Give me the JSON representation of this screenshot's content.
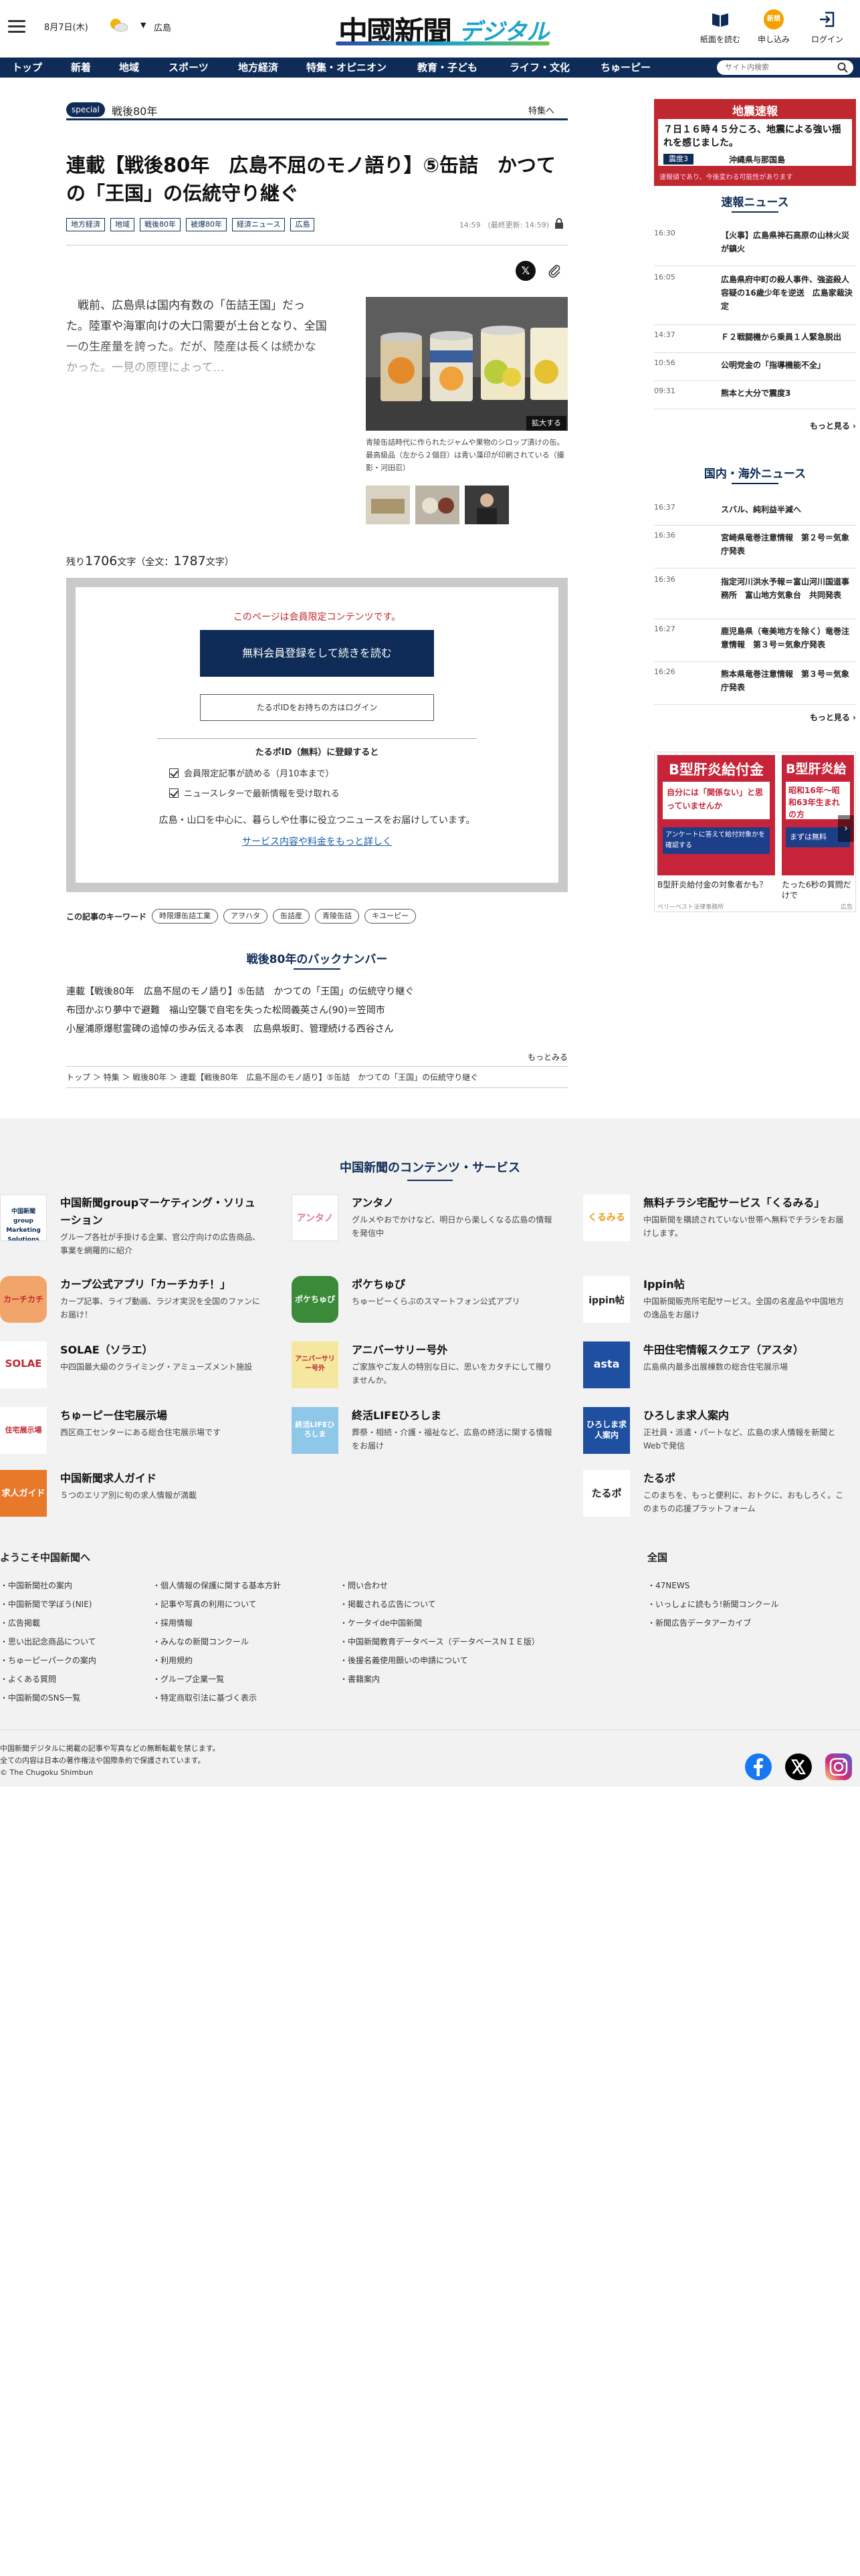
{
  "header": {
    "date": "8月7日(木)",
    "weather_place": "広島",
    "logo_main": "中國新聞",
    "logo_sub": "デジタル",
    "paper_label": "紙面を読む",
    "subscribe_label": "申し込み",
    "subscribe_badge": "新規",
    "login_label": "ログイン"
  },
  "nav": {
    "items": [
      "トップ",
      "新着",
      "地域",
      "スポーツ",
      "地方経済",
      "特集・オピニオン",
      "教育・子ども",
      "ライフ・文化",
      "ちゅーピー"
    ],
    "search_placeholder": "サイト内検索"
  },
  "article": {
    "special_badge": "special",
    "special_title": "戦後80年",
    "special_link": "特集へ",
    "title": "連載【戦後80年　広島不屈のモノ語り】⑤缶詰　かつての「王国」の伝統守り継ぐ",
    "tags": [
      "地方経済",
      "地域",
      "戦後80年",
      "被爆80年",
      "経済ニュース",
      "広島"
    ],
    "time": "14:59　(最終更新: 14:59)",
    "lead": "戦前、広島県は国内有数の「缶詰王国」だった。陸軍や海軍向けの大口需要が土台となり、全国一の生産量を誇った。だが、陸産は長くは続かなかった。一見の原理によって…",
    "photo_expand": "拡大する",
    "photo_caption": "青陵缶詰時代に作られたジャムや果物のシロップ漬けの缶。最高級品（左から２個目）は青い藻印が印刷されている（撮影・河田忍）",
    "remain_label": "残り",
    "remain_count": "1706",
    "remain_unit": "文字（全文：",
    "total_count": "1787",
    "total_unit": "文字）"
  },
  "paywall": {
    "message": "このページは会員限定コンテンツです。",
    "register_button": "無料会員登録をして続きを読む",
    "login_button": "たるポIDをお持ちの方はログイン",
    "heading": "たるポID（無料）に登録すると",
    "benefit1": "会員限定記事が読める（月10本まで）",
    "benefit2": "ニュースレターで最新情報を受け取れる",
    "info": "広島・山口を中心に、暮らしや仕事に役立つニュースをお届けしています。",
    "more_link": "サービス内容や料金をもっと詳しく"
  },
  "keywords": {
    "label": "この記事のキーワード",
    "items": [
      "時限爆缶詰工業",
      "アヲハタ",
      "缶詰産",
      "青陵缶詰",
      "キユーピー"
    ]
  },
  "backnumber": {
    "heading": "戦後80年のバックナンバー",
    "items": [
      "連載【戦後80年　広島不屈のモノ語り】⑤缶詰　かつての「王国」の伝統守り継ぐ",
      "布団かぶり夢中で避難　福山空襲で自宅を失った松岡義英さん(90)＝笠岡市",
      "小屋浦原爆慰霊碑の追悼の歩み伝える本表　広島県坂町、管理続ける西谷さん"
    ],
    "more": "もっとみる"
  },
  "breadcrumb": "トップ ＞ 特集 ＞ 戦後80年 ＞ 連載【戦後80年　広島不屈のモノ語り】⑤缶詰　かつての「王国」の伝統守り継ぐ",
  "sidebar": {
    "quake_heading": "地震速報",
    "quake_text": "７日１６時４５分ころ、地震による強い揺れを感じました。",
    "quake_level": "震度3",
    "quake_area": "沖縄県与那国島",
    "quake_note": "速報値であり、今後変わる可能性があります",
    "breaking_heading": "速報ニュース",
    "breaking": [
      {
        "time": "16:30",
        "title": "【火事】広島県神石高原の山林火災が鎮火"
      },
      {
        "time": "16:05",
        "title": "広島県府中町の殺人事件、強盗殺人容疑の16歳少年を逆送　広島家裁決定"
      },
      {
        "time": "14:37",
        "title": "Ｆ２戦闘機から乗員１人緊急脱出"
      },
      {
        "time": "10:56",
        "title": "公明党金の「指導機能不全」"
      },
      {
        "time": "09:31",
        "title": "熊本と大分で震度3"
      }
    ],
    "breaking_more": "もっと見る ›",
    "world_heading": "国内・海外ニュース",
    "world": [
      {
        "time": "16:37",
        "title": "スバル、純利益半減へ"
      },
      {
        "time": "16:36",
        "title": "宮崎県竜巻注意情報　第２号＝気象庁発表"
      },
      {
        "time": "16:36",
        "title": "指定河川洪水予報＝富山河川国道事務所　富山地方気象台　共同発表"
      },
      {
        "time": "16:27",
        "title": "鹿児島県（奄美地方を除く）竜巻注意情報　第３号＝気象庁発表"
      },
      {
        "time": "16:26",
        "title": "熊本県竜巻注意情報　第３号＝気象庁発表"
      }
    ],
    "world_more": "もっと見る ›",
    "ad_card1_head": "B型肝炎給付金",
    "ad_card1_sub": "自分には「関係ない」と思っていませんか",
    "ad_card1_btn": "アンケートに答えて給付対象かを確認する",
    "ad_card2_head": "B型肝炎給",
    "ad_card2_sub": "昭和16年〜昭和63年生まれの方",
    "ad_card2_btn": "まずは無料",
    "ad_caption1": "B型肝炎給付金の対象者かも？",
    "ad_caption2": "たった6秒の質問だけで",
    "ad_source": "ベリーベスト法律事務所",
    "ad_label": "広告"
  },
  "footer": {
    "heading": "中国新聞のコンテンツ・サービス",
    "services": [
      {
        "title": "中国新聞groupマーケティング・ソリューション",
        "desc": "グループ各社が手掛ける企業、官公庁向けの広告商品、事業を網羅的に紹介"
      },
      {
        "title": "アンタノ",
        "desc": "グルメやおでかけなど、明日から楽しくなる広島の情報を発信中"
      },
      {
        "title": "無料チラシ宅配サービス「くるみる」",
        "desc": "中国新聞を購読されていない世帯へ無料でチラシをお届けします。"
      },
      {
        "title": "カープ公式アプリ「カーチカチ！」",
        "desc": "カープ記事、ライブ動画、ラジオ実況を全国のファンにお届け！"
      },
      {
        "title": "ポケちゅぴ",
        "desc": "ちゅーピーくらぶのスマートフォン公式アプリ"
      },
      {
        "title": "Ippin帖",
        "desc": "中国新聞販売所宅配サービス。全国の名産品や中国地方の逸品をお届け"
      },
      {
        "title": "SOLAE（ソラエ）",
        "desc": "中四国最大級のクライミング・アミューズメント施設"
      },
      {
        "title": "アニバーサリー号外",
        "desc": "ご家族やご友人の特別な日に、思いをカタチにして贈りませんか。"
      },
      {
        "title": "牛田住宅情報スクエア（アスタ）",
        "desc": "広島県内最多出展棟数の総合住宅展示場"
      },
      {
        "title": "ちゅーピー住宅展示場",
        "desc": "西区商工センターにある総合住宅展示場です"
      },
      {
        "title": "終活LIFEひろしま",
        "desc": "葬祭・相続・介護・福祉など、広島の終活に関する情報をお届け"
      },
      {
        "title": "ひろしま求人案内",
        "desc": "正社員・派遣・パートなど、広島の求人情報を新聞とWebで発信"
      },
      {
        "title": "中国新聞求人ガイド",
        "desc": "５つのエリア別に旬の求人情報が満載"
      },
      {
        "title": "たるポ",
        "desc": "このまちを、もっと便利に、おトクに、おもしろく。このまちの応援プラットフォーム"
      }
    ],
    "service_logos": [
      "中国新聞group Marketing Solutions",
      "アンタノ",
      "くるみる",
      "カーチカチ",
      "ポケちゅぴ",
      "ippin帖",
      "SOLAE",
      "アニバーサリー号外",
      "asta",
      "住宅展示場",
      "終活LIFEひろしま",
      "ひろしま求人案内",
      "求人ガイド",
      "たるポ"
    ],
    "welcome_heading": "ようこそ中国新聞へ",
    "col1": [
      "中国新聞社の案内",
      "中国新聞で学ぼう(NIE)",
      "広告掲載",
      "思い出記念商品について",
      "ちゅーピーパークの案内",
      "よくある質問",
      "中国新聞のSNS一覧"
    ],
    "col2": [
      "個人情報の保護に関する基本方針",
      "記事や写真の利用について",
      "採用情報",
      "みんなの新聞コンクール",
      "利用規約",
      "グループ企業一覧",
      "特定商取引法に基づく表示"
    ],
    "col3": [
      "問い合わせ",
      "掲載される広告について",
      "ケータイde中国新聞",
      "中国新聞教育データベース（データベースＮＩＥ版）",
      "後援名義使用願いの申請について",
      "書籍案内"
    ],
    "national_heading": "全国",
    "col4": [
      "47NEWS",
      "いっしょに読もう!新聞コンクール",
      "新聞広告データアーカイブ"
    ],
    "copyright1": "中国新聞デジタルに掲載の記事や写真などの無断転載を禁じます。",
    "copyright2": "全ての内容は日本の著作権法や国際条約で保護されています。",
    "copyright3": "© The Chugoku Shimbun"
  },
  "colors": {
    "navy": "#0e2c57",
    "red": "#c0282f",
    "orange": "#f4a100",
    "cyan": "#1aa3c9"
  }
}
